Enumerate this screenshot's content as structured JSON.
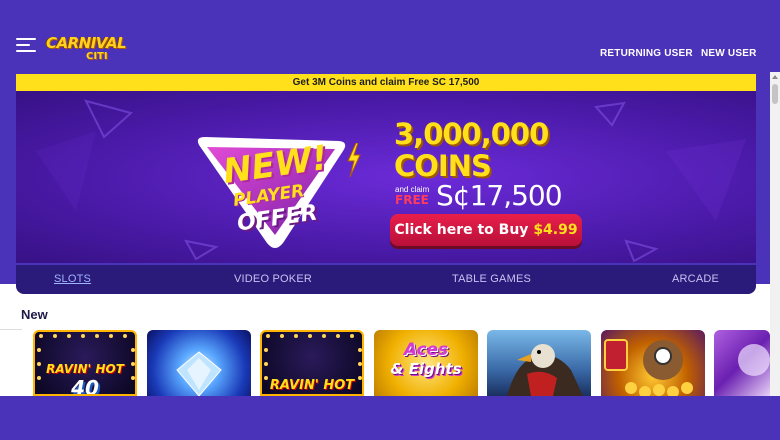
{
  "header": {
    "logo_text": "CARNIVAL",
    "logo_sub": "CITI",
    "returning_user": "RETURNING USER",
    "new_user": "NEW USER"
  },
  "promo_strip": "Get 3M Coins and claim Free SC 17,500",
  "banner": {
    "badge_line1": "NEW!",
    "badge_line2": "PLAYER",
    "badge_line3": "OFFER",
    "coins_amount": "3,000,000",
    "coins_label": "COINS",
    "and_claim": "and claim",
    "free": "FREE",
    "sc_amount": "S¢17,500",
    "buy_text": "Click here to Buy ",
    "buy_price": "$4.99"
  },
  "tabs": [
    {
      "label": "SLOTS",
      "active": true
    },
    {
      "label": "VIDEO POKER",
      "active": false
    },
    {
      "label": "TABLE GAMES",
      "active": false
    },
    {
      "label": "ARCADE",
      "active": false
    }
  ],
  "section": {
    "title": "New"
  },
  "games": [
    {
      "title_top": "RAVIN' HOT",
      "title_bottom": "40"
    },
    {
      "title_top": "",
      "title_bottom": ""
    },
    {
      "title_top": "RAVIN' HOT",
      "title_bottom": ""
    },
    {
      "title_top": "Aces",
      "title_bottom": "& Eights"
    },
    {
      "title_top": "",
      "title_bottom": ""
    },
    {
      "title_top": "",
      "title_bottom": ""
    },
    {
      "title_top": "",
      "title_bottom": ""
    }
  ],
  "colors": {
    "page_bg": "#4a33b8",
    "promo_strip": "#ffe01b",
    "buy_button": "#e81f4a",
    "tabs_bg": "#2a1a7a",
    "accent_yellow": "#ffe01b"
  }
}
